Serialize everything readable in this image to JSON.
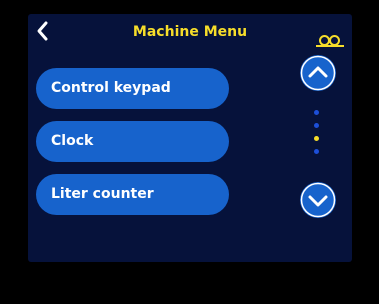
{
  "header": {
    "title": "Machine Menu",
    "back_icon": "chevron-left-icon",
    "machine_icon": "coffee-machine-icon"
  },
  "menu": {
    "items": [
      {
        "label": "Control keypad"
      },
      {
        "label": "Clock"
      },
      {
        "label": "Liter counter"
      }
    ]
  },
  "pager": {
    "up_icon": "chevron-up-icon",
    "down_icon": "chevron-down-icon",
    "page_count": 4,
    "current_page": 3
  },
  "colors": {
    "screen_background": "#06123b",
    "button_fill": "#1763cc",
    "title_accent": "#f6dd2a",
    "active_dot": "#f6dd2a",
    "inactive_dot": "#1d4fd8"
  }
}
